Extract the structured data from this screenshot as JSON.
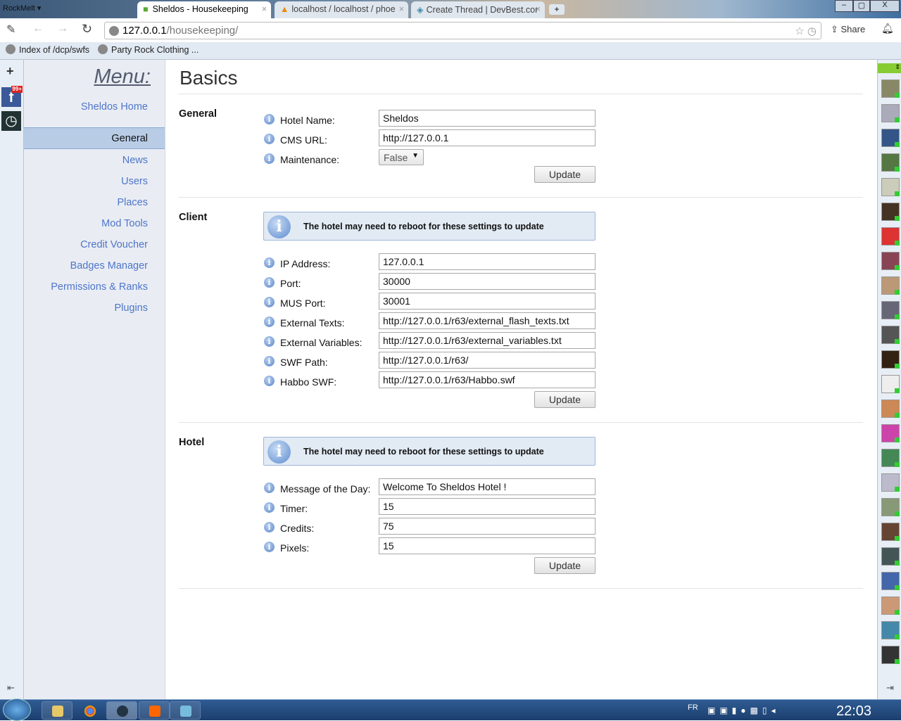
{
  "browser": {
    "brand": "RockMelt",
    "tabs": [
      {
        "title": "Sheldos - Housekeeping",
        "active": true
      },
      {
        "title": "localhost / localhost / phoe"
      },
      {
        "title": "Create Thread | DevBest.cor"
      }
    ],
    "url_host": "127.0.0.1",
    "url_path": "/housekeeping/",
    "share_label": "Share",
    "bookmarks": [
      "Index of /dcp/swfs",
      "Party Rock Clothing ..."
    ],
    "badge": "99+"
  },
  "menu": {
    "title": "Menu:",
    "home": "Sheldos Home",
    "items": [
      {
        "label": "General",
        "active": true
      },
      {
        "label": "News"
      },
      {
        "label": "Users"
      },
      {
        "label": "Places"
      },
      {
        "label": "Mod Tools"
      },
      {
        "label": "Credit Voucher"
      },
      {
        "label": "Badges Manager"
      },
      {
        "label": "Permissions & Ranks"
      },
      {
        "label": "Plugins"
      }
    ]
  },
  "page": {
    "title": "Basics",
    "update_label": "Update",
    "notice": "The hotel may need to reboot for these settings to update",
    "general": {
      "title": "General",
      "fields": [
        {
          "label": "Hotel Name:",
          "value": "Sheldos"
        },
        {
          "label": "CMS URL:",
          "value": "http://127.0.0.1"
        },
        {
          "label": "Maintenance:",
          "value": "False"
        }
      ]
    },
    "client": {
      "title": "Client",
      "fields": [
        {
          "label": "IP Address:",
          "value": "127.0.0.1"
        },
        {
          "label": "Port:",
          "value": "30000"
        },
        {
          "label": "MUS Port:",
          "value": "30001"
        },
        {
          "label": "External Texts:",
          "value": "http://127.0.0.1/r63/external_flash_texts.txt"
        },
        {
          "label": "External Variables:",
          "value": "http://127.0.0.1/r63/external_variables.txt"
        },
        {
          "label": "SWF Path:",
          "value": "http://127.0.0.1/r63/"
        },
        {
          "label": "Habbo SWF:",
          "value": "http://127.0.0.1/r63/Habbo.swf"
        }
      ]
    },
    "hotel": {
      "title": "Hotel",
      "fields": [
        {
          "label": "Message of the Day:",
          "value": "Welcome To Sheldos Hotel !"
        },
        {
          "label": "Timer:",
          "value": "15"
        },
        {
          "label": "Credits:",
          "value": "75"
        },
        {
          "label": "Pixels:",
          "value": "15"
        }
      ]
    }
  },
  "taskbar": {
    "lang": "FR",
    "clock": "22:03"
  }
}
